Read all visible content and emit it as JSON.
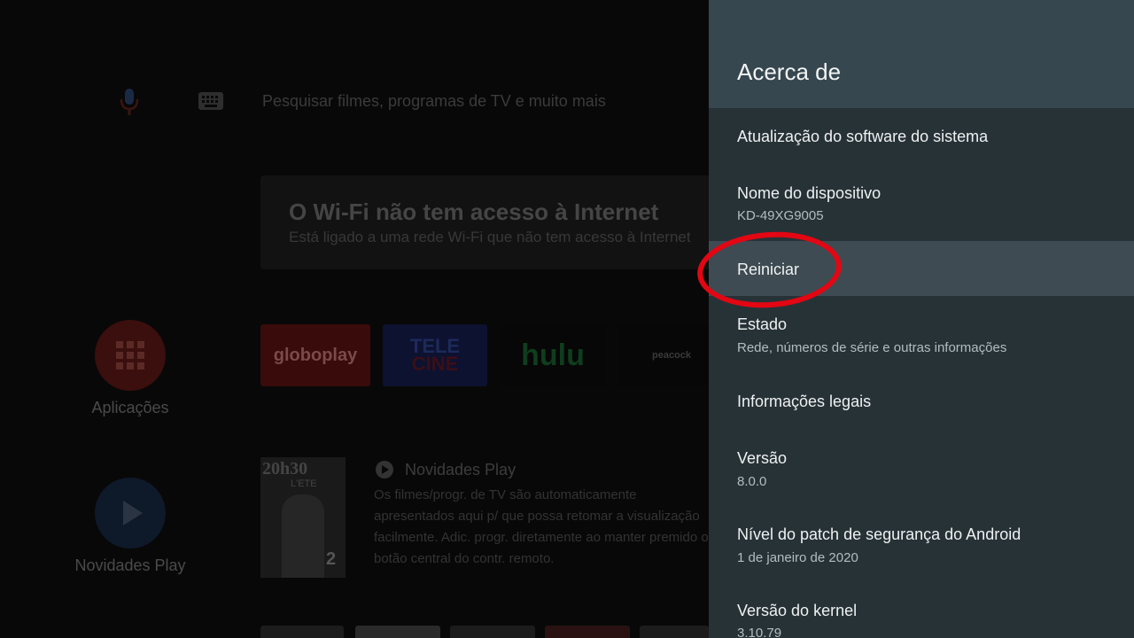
{
  "home": {
    "search_placeholder": "Pesquisar filmes, programas de TV e muito mais",
    "wifi_card": {
      "title": "O Wi-Fi não tem acesso à Internet",
      "subtitle": "Está ligado a uma rede Wi-Fi que não tem acesso à Internet"
    },
    "sidebar": {
      "apps_label": "Aplicações",
      "play_label": "Novidades Play"
    },
    "apps": [
      "globoplay",
      "TELE",
      "CINE",
      "hulu",
      "peacock"
    ],
    "promo": {
      "image_title": "20h30",
      "image_subtitle": "L'ETE",
      "image_channel": "2",
      "title": "Novidades Play",
      "description_lines": [
        "Os filmes/progr. de TV são automaticamente",
        "apresentados aqui p/ que possa retomar a visualização",
        "facilmente. Adic. progr. diretamente ao manter premido o",
        "botão central do contr. remoto."
      ]
    }
  },
  "panel": {
    "title": "Acerca de",
    "items": [
      {
        "label": "Atualização do software do sistema",
        "sub": ""
      },
      {
        "label": "Nome do dispositivo",
        "sub": "KD-49XG9005"
      },
      {
        "label": "Reiniciar",
        "sub": ""
      },
      {
        "label": "Estado",
        "sub": "Rede, números de série e outras informações"
      },
      {
        "label": "Informações legais",
        "sub": ""
      },
      {
        "label": "Versão",
        "sub": "8.0.0"
      },
      {
        "label": "Nível do patch de segurança do Android",
        "sub": "1 de janeiro de 2020"
      },
      {
        "label": "Versão do kernel",
        "sub": "3.10.79"
      }
    ]
  },
  "colors": {
    "panel_bg": "#273237",
    "panel_header_bg": "#37474f",
    "focused_item_bg": "#3e4b52",
    "highlight_ring": "#e30613"
  },
  "icons": [
    "microphone-icon",
    "keyboard-icon",
    "apps-grid-icon",
    "play-icon"
  ]
}
